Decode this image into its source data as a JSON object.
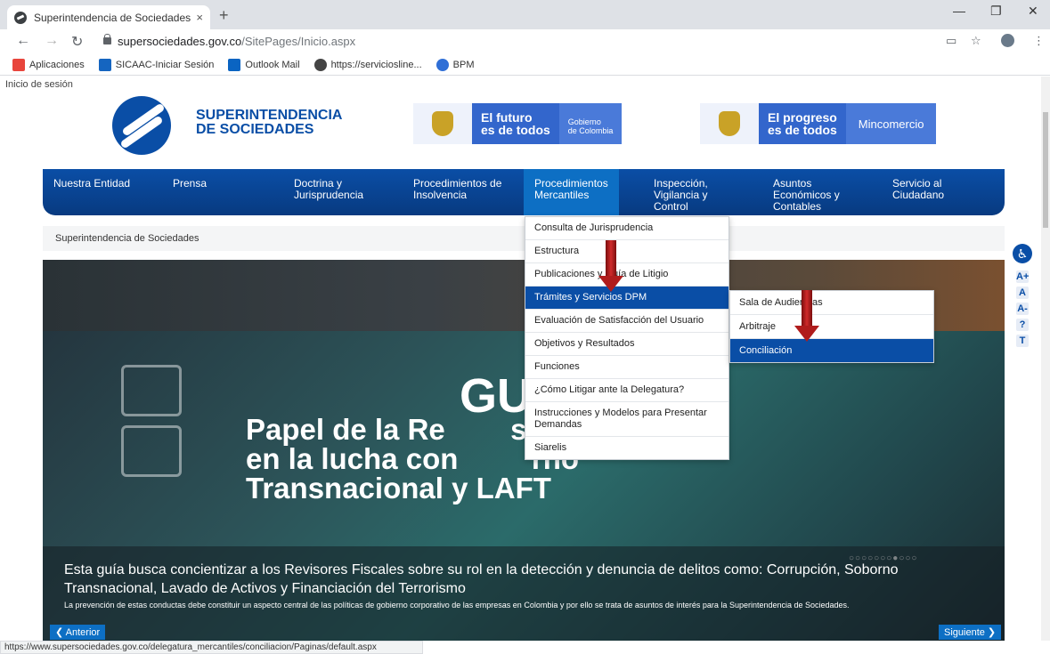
{
  "browser": {
    "tab_title": "Superintendencia de Sociedades",
    "tab_close": "×",
    "new_tab": "+",
    "url_host": "supersociedades.gov.co",
    "url_path": "/SitePages/Inicio.aspx",
    "bookmarks": [
      {
        "label": "Aplicaciones",
        "color": "#e8453c"
      },
      {
        "label": "SICAAC-Iniciar Sesión",
        "color": "#1565c0"
      },
      {
        "label": "Outlook Mail",
        "color": "#0a64c2"
      },
      {
        "label": "https://serviciosline...",
        "color": "#444444"
      },
      {
        "label": "BPM",
        "color": "#2f6fd6"
      }
    ],
    "status_url": "https://www.supersociedades.gov.co/delegatura_mercantiles/conciliacion/Paginas/default.aspx"
  },
  "page": {
    "login": "Inicio de sesión",
    "brand_line1": "SUPERINTENDENCIA",
    "brand_line2": "DE SOCIEDADES",
    "gov1_slogan1": "El futuro",
    "gov1_slogan2": "es de todos",
    "gov1_sub1": "Gobierno",
    "gov1_sub2": "de Colombia",
    "gov2_slogan1": "El progreso",
    "gov2_slogan2": "es de todos",
    "gov2_sub": "Mincomercio",
    "breadcrumb": "Superintendencia de Sociedades"
  },
  "nav": {
    "items": [
      {
        "l1": "Nuestra Entidad",
        "l2": "",
        "l3": ""
      },
      {
        "l1": "Prensa",
        "l2": "",
        "l3": ""
      },
      {
        "l1": "Doctrina y",
        "l2": "Jurisprudencia",
        "l3": ""
      },
      {
        "l1": "Procedimientos de",
        "l2": "Insolvencia",
        "l3": ""
      },
      {
        "l1": "Procedimientos",
        "l2": "Mercantiles",
        "l3": ""
      },
      {
        "l1": "Inspección,",
        "l2": "Vigilancia y",
        "l3": "Control"
      },
      {
        "l1": "Asuntos",
        "l2": "Económicos y",
        "l3": "Contables"
      },
      {
        "l1": "Servicio al",
        "l2": "Ciudadano",
        "l3": ""
      }
    ]
  },
  "dropdown": {
    "items": [
      "Consulta de Jurisprudencia",
      "Estructura",
      "Publicaciones y Guía de Litigio",
      "Trámites y Servicios DPM",
      "Evaluación de Satisfacción del Usuario",
      "Objetivos y Resultados",
      "Funciones",
      "¿Cómo Litigar ante la Delegatura?",
      "Instrucciones y Modelos para Presentar Demandas",
      "Siarelis"
    ]
  },
  "submenu": {
    "items": [
      "Sala de Audiencias",
      "Arbitraje",
      "Conciliación"
    ]
  },
  "hero": {
    "gu": "GU",
    "headline1": "Papel de la Re        scal",
    "headline2": "en la lucha con         rno",
    "headline3": "Transnacional y LAFT",
    "dots": "○○○○○○○●○○○",
    "caption1": "Esta guía busca concientizar a los Revisores Fiscales sobre su rol en la detección y denuncia de delitos como: Corrupción, Soborno Transnacional, Lavado de Activos y Financiación del Terrorismo",
    "caption2": "La prevención de estas conductas debe constituir un aspecto central de las políticas de gobierno corporativo de las empresas en Colombia y por ello se trata de asuntos de interés para la Superintendencia de Sociedades.",
    "prev": "❮ Anterior",
    "next": "Siguiente ❯"
  },
  "accessibility": {
    "items": [
      "A+",
      "A",
      "A-",
      "?",
      "T"
    ]
  }
}
